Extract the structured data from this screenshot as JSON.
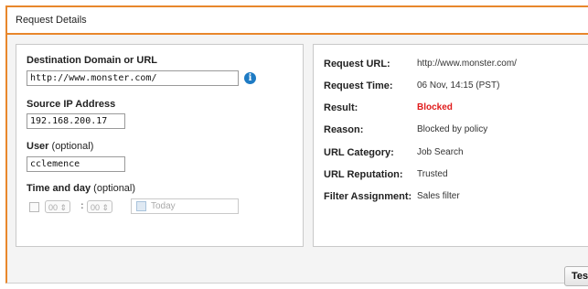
{
  "panel": {
    "title": "Request Details"
  },
  "form": {
    "destination_label": "Destination Domain or URL",
    "destination_value": "http://www.monster.com/",
    "info_icon": "info-icon",
    "source_ip_label": "Source IP Address",
    "source_ip_value": "192.168.200.17",
    "user_label": "User",
    "user_optional": "(optional)",
    "user_value": "cclemence",
    "time_label": "Time and day",
    "time_optional": "(optional)",
    "hour_value": "00",
    "minute_value": "00",
    "date_placeholder": "Today",
    "calendar_icon": "calendar-icon"
  },
  "result": {
    "rows": [
      {
        "key": "Request URL:",
        "value": "http://www.monster.com/"
      },
      {
        "key": "Request Time:",
        "value": "06 Nov, 14:15 (PST)"
      },
      {
        "key": "Result:",
        "value": "Blocked"
      },
      {
        "key": "Reason:",
        "value": "Blocked by policy"
      },
      {
        "key": "URL Category:",
        "value": "Job Search"
      },
      {
        "key": "URL Reputation:",
        "value": "Trusted"
      },
      {
        "key": "Filter Assignment:",
        "value": "Sales filter"
      }
    ],
    "blocked_color": "#e01b1b"
  },
  "footer": {
    "test_button": "Test"
  },
  "colors": {
    "accent": "#e8872c",
    "info": "#1e7bc4"
  }
}
